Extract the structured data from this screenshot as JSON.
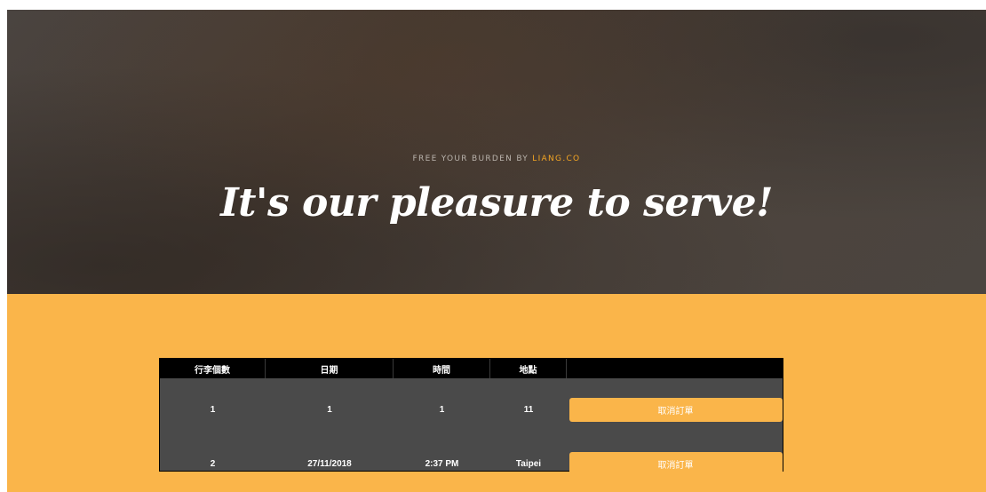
{
  "hero": {
    "tagline_prefix": "FREE YOUR BURDEN BY ",
    "tagline_brand": "LIANG.CO",
    "heading": "It's our pleasure to serve!"
  },
  "table": {
    "headers": [
      "行李個數",
      "日期",
      "時間",
      "地點",
      ""
    ],
    "rows": [
      {
        "count": "1",
        "date": "1",
        "time": "1",
        "location": "11",
        "action": "取消訂單"
      },
      {
        "count": "2",
        "date": "27/11/2018",
        "time": "2:37 PM",
        "location": "Taipei",
        "action": "取消訂單"
      }
    ]
  },
  "colors": {
    "accent": "#fab54a",
    "brand": "#f5a623",
    "table_body": "#4a4a4a",
    "table_header": "#000000"
  }
}
